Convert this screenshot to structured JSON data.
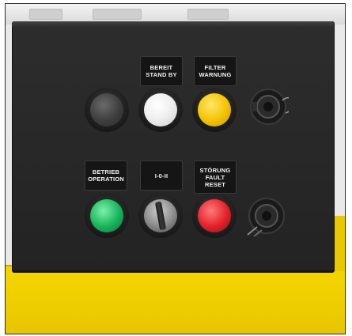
{
  "panel": {
    "labels": {
      "bereit": [
        "BEREIT",
        "STAND BY"
      ],
      "filter": [
        "FILTER",
        "WARNUNG"
      ],
      "betrieb": [
        "BETRIEB",
        "OPERATION"
      ],
      "selector": [
        "I-0-II"
      ],
      "stoerung": [
        "STÖRUNG",
        "FAULT",
        "RESET"
      ]
    }
  },
  "colors": {
    "panel": "#262626",
    "yellow_housing": "#f1d000",
    "lamp_dark": "#3e3e3e",
    "lamp_white": "#f0f0f0",
    "lamp_yellow": "#f3c200",
    "lamp_green": "#16b35a",
    "lamp_red": "#e2202a"
  },
  "icons": {
    "connector_top": "cable-connector-icon",
    "connector_bottom": "cable-connector-icon",
    "selector_switch": "rotary-selector-icon"
  }
}
